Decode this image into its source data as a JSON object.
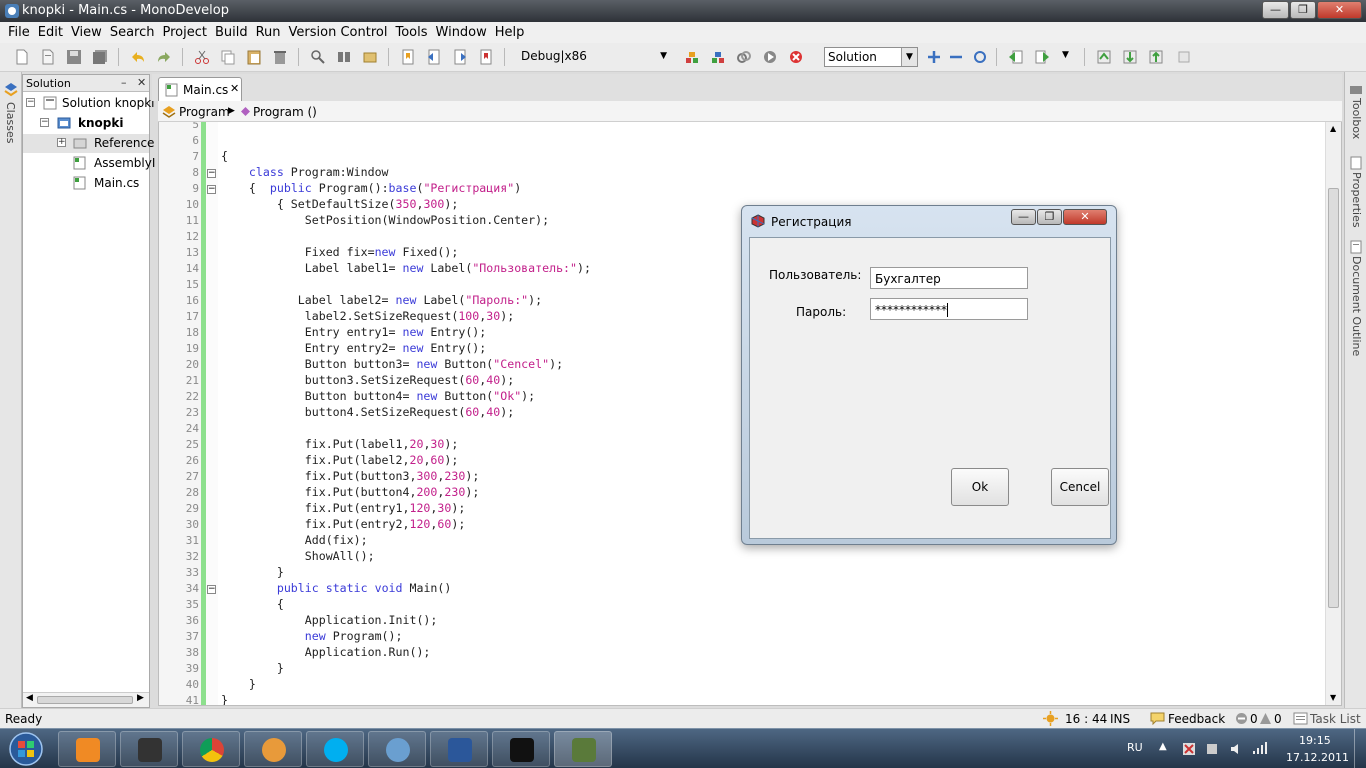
{
  "window": {
    "title": "knopki - Main.cs - MonoDevelop",
    "controls": [
      "minimize",
      "maximize",
      "close"
    ]
  },
  "menu": [
    "File",
    "Edit",
    "View",
    "Search",
    "Project",
    "Build",
    "Run",
    "Version Control",
    "Tools",
    "Window",
    "Help"
  ],
  "toolbar": {
    "config": "Debug|x86",
    "solution_combo": "Solution"
  },
  "left_strip": {
    "classes_label": "Classes"
  },
  "right_strip": {
    "toolbox": "Toolbox",
    "properties": "Properties",
    "document_outline": "Document Outline"
  },
  "solution_pad": {
    "title": "Solution",
    "items": [
      {
        "label": "Solution knopki"
      },
      {
        "label": "knopki"
      },
      {
        "label": "Reference"
      },
      {
        "label": "AssemblyI"
      },
      {
        "label": "Main.cs"
      }
    ]
  },
  "editor": {
    "tab": {
      "label": "Main.cs"
    },
    "breadcrumb": [
      "Program",
      "Program ()"
    ],
    "lines": [
      {
        "n": "5",
        "t": ""
      },
      {
        "n": "6",
        "t": ""
      },
      {
        "n": "7",
        "t": "{"
      },
      {
        "n": "8",
        "t": "    class Program:Window"
      },
      {
        "n": "9",
        "t": "    {  public Program():base(\"Регистрация\")"
      },
      {
        "n": "10",
        "t": "        { SetDefaultSize(350,300);"
      },
      {
        "n": "11",
        "t": "            SetPosition(WindowPosition.Center);"
      },
      {
        "n": "12",
        "t": ""
      },
      {
        "n": "13",
        "t": "            Fixed fix=new Fixed();"
      },
      {
        "n": "14",
        "t": "            Label label1= new Label(\"Пользователь:\");"
      },
      {
        "n": "15",
        "t": ""
      },
      {
        "n": "16",
        "t": "           Label label2= new Label(\"Пароль:\");"
      },
      {
        "n": "17",
        "t": "            label2.SetSizeRequest(100,30);"
      },
      {
        "n": "18",
        "t": "            Entry entry1= new Entry();"
      },
      {
        "n": "19",
        "t": "            Entry entry2= new Entry();"
      },
      {
        "n": "20",
        "t": "            Button button3= new Button(\"Cencel\");"
      },
      {
        "n": "21",
        "t": "            button3.SetSizeRequest(60,40);"
      },
      {
        "n": "22",
        "t": "            Button button4= new Button(\"Ok\");"
      },
      {
        "n": "23",
        "t": "            button4.SetSizeRequest(60,40);"
      },
      {
        "n": "24",
        "t": ""
      },
      {
        "n": "25",
        "t": "            fix.Put(label1,20,30);"
      },
      {
        "n": "26",
        "t": "            fix.Put(label2,20,60);"
      },
      {
        "n": "27",
        "t": "            fix.Put(button3,300,230);"
      },
      {
        "n": "28",
        "t": "            fix.Put(button4,200,230);"
      },
      {
        "n": "29",
        "t": "            fix.Put(entry1,120,30);"
      },
      {
        "n": "30",
        "t": "            fix.Put(entry2,120,60);"
      },
      {
        "n": "31",
        "t": "            Add(fix);"
      },
      {
        "n": "32",
        "t": "            ShowAll();"
      },
      {
        "n": "33",
        "t": "        }"
      },
      {
        "n": "34",
        "t": "        public static void Main()"
      },
      {
        "n": "35",
        "t": "        {"
      },
      {
        "n": "36",
        "t": "            Application.Init();"
      },
      {
        "n": "37",
        "t": "            new Program();"
      },
      {
        "n": "38",
        "t": "            Application.Run();"
      },
      {
        "n": "39",
        "t": "        }"
      },
      {
        "n": "40",
        "t": "    }"
      },
      {
        "n": "41",
        "t": "}"
      }
    ]
  },
  "dialog": {
    "title": "Регистрация",
    "user_label": "Пользователь:",
    "user_value": "Бухгалтер",
    "pass_label": "Пароль:",
    "pass_value": "************",
    "ok_label": "Ok",
    "cancel_label": "Cencel"
  },
  "statusbar": {
    "status": "Ready",
    "position": "16 : 44",
    "mode": "INS",
    "feedback": "Feedback",
    "errors": "0",
    "warnings": "0",
    "tasklist": "Task List"
  },
  "taskbar": {
    "lang": "RU",
    "time": "19:15",
    "date": "17.12.2011",
    "apps": [
      "media-player",
      "file-manager",
      "chrome",
      "gadget",
      "skype",
      "monodevelop",
      "word",
      "console",
      "gtk-app"
    ]
  },
  "colors": {
    "keyword": "#3b3bd8",
    "string": "#c21f8a",
    "change_bar": "#8de08d"
  }
}
